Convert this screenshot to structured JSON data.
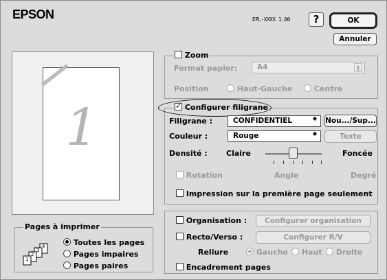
{
  "header": {
    "brand": "EPSON",
    "model": "EPL-XXXX 1.00",
    "help_label": "?",
    "ok_label": "OK",
    "cancel_label": "Annuler"
  },
  "preview": {
    "page_number": "1"
  },
  "zoom": {
    "checkbox_label": "Zoom",
    "checked": false,
    "paper_format_label": "Format papier:",
    "paper_format_value": "A4",
    "position_label": "Position",
    "position_options": [
      "Haut-Gauche",
      "Centre"
    ]
  },
  "watermark": {
    "checkbox_label": "Configurer filigrane",
    "checked": true,
    "filigrane_label": "Filigrane :",
    "filigrane_value": "CONFIDENTIEL",
    "new_button": "Nou.../Sup...",
    "color_label": "Couleur :",
    "color_value": "Rouge",
    "text_button": "Texte",
    "density_label": "Densité :",
    "density_low": "Claire",
    "density_high": "Foncée",
    "density_level": 0.5,
    "rotation_label": "Rotation",
    "angle_label": "Angle",
    "degree_label": "Degré",
    "first_page_only_label": "Impression sur la première page seulement"
  },
  "pages_to_print": {
    "title": "Pages à imprimer",
    "options": [
      "Toutes les pages",
      "Pages impaires",
      "Pages paires"
    ],
    "selected_index": 0,
    "icon_numbers": [
      "1",
      "2",
      "3",
      "4"
    ]
  },
  "layout": {
    "organisation_label": "Organisation :",
    "organisation_button": "Configurer organisation",
    "duplex_label": "Recto/Verso :",
    "duplex_button": "Configurer R/V",
    "binding_label": "Reliure",
    "binding_options": [
      "Gauche",
      "Haut",
      "Droite"
    ],
    "binding_selected": 0,
    "frame_label": "Encadrement pages"
  },
  "colors": {
    "window_bg": "#dcdcdc",
    "watermark_mark": "#b0b0b0"
  }
}
